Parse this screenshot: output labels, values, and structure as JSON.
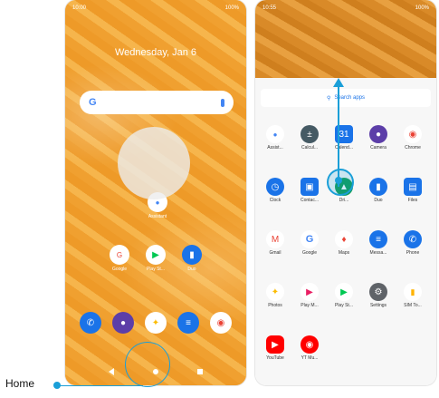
{
  "left_screen": {
    "status_time": "10:00",
    "status_battery": "100%",
    "date": "Wednesday, Jan 6",
    "search_brand": "G",
    "apps": [
      {
        "label": "Assistant",
        "icon": "assistant-icon",
        "color": "#ffffff"
      },
      {
        "label": "Google",
        "icon": "google-folder-icon",
        "color": "#ffffff"
      },
      {
        "label": "Play St...",
        "icon": "play-store-icon",
        "color": "#ffffff"
      },
      {
        "label": "Duo",
        "icon": "duo-icon",
        "color": "#1a73e8"
      }
    ],
    "dock": [
      {
        "icon": "phone-icon",
        "color": "#1a73e8"
      },
      {
        "icon": "camera-icon",
        "color": "#5c3ea8"
      },
      {
        "icon": "photos-icon",
        "color": "#ffffff"
      },
      {
        "icon": "messages-icon",
        "color": "#1a73e8"
      },
      {
        "icon": "chrome-icon",
        "color": "#ffffff"
      }
    ]
  },
  "right_screen": {
    "status_time": "10:55",
    "status_battery": "100%",
    "search_label": "Search apps",
    "apps": [
      {
        "label": "Assist...",
        "icon": "assistant-icon",
        "color": "#ffffff"
      },
      {
        "label": "Calcul...",
        "icon": "calculator-icon",
        "color": "#455a64"
      },
      {
        "label": "Calend...",
        "icon": "calendar-icon",
        "color": "#1a73e8"
      },
      {
        "label": "Camera",
        "icon": "camera-icon",
        "color": "#5c3ea8"
      },
      {
        "label": "Chrome",
        "icon": "chrome-icon",
        "color": "#ffffff"
      },
      {
        "label": "Clock",
        "icon": "clock-icon",
        "color": "#1a73e8"
      },
      {
        "label": "Contac...",
        "icon": "contacts-icon",
        "color": "#1a73e8"
      },
      {
        "label": "Dri...",
        "icon": "drive-icon",
        "color": "#0f9d58"
      },
      {
        "label": "Duo",
        "icon": "duo-icon",
        "color": "#1a73e8"
      },
      {
        "label": "Files",
        "icon": "files-icon",
        "color": "#1a73e8"
      },
      {
        "label": "Gmail",
        "icon": "gmail-icon",
        "color": "#ffffff"
      },
      {
        "label": "Google",
        "icon": "google-icon",
        "color": "#ffffff"
      },
      {
        "label": "Maps",
        "icon": "maps-icon",
        "color": "#ffffff"
      },
      {
        "label": "Messa...",
        "icon": "messages-icon",
        "color": "#1a73e8"
      },
      {
        "label": "Phone",
        "icon": "phone-icon",
        "color": "#1a73e8"
      },
      {
        "label": "Photos",
        "icon": "photos-icon",
        "color": "#ffffff"
      },
      {
        "label": "Play M...",
        "icon": "play-movies-icon",
        "color": "#ffffff"
      },
      {
        "label": "Play St...",
        "icon": "play-store-icon",
        "color": "#ffffff"
      },
      {
        "label": "Settings",
        "icon": "settings-icon",
        "color": "#5f6368"
      },
      {
        "label": "SIM To...",
        "icon": "sim-toolkit-icon",
        "color": "#ffffff"
      },
      {
        "label": "YouTube",
        "icon": "youtube-icon",
        "color": "#ff0000"
      },
      {
        "label": "YT Mu...",
        "icon": "youtube-music-icon",
        "color": "#ff0000"
      }
    ]
  },
  "callout": {
    "label": "Home"
  }
}
